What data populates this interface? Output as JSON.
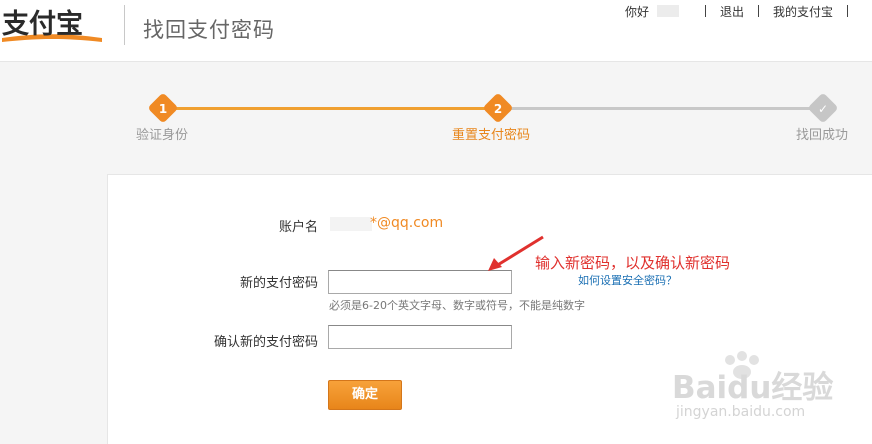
{
  "header": {
    "logo_text": "支付宝",
    "title": "找回支付密码",
    "nav": {
      "greeting": "你好",
      "logout": "退出",
      "my_alipay": "我的支付宝"
    }
  },
  "steps": [
    {
      "number": "1",
      "label": "验证身份",
      "state": "done"
    },
    {
      "number": "2",
      "label": "重置支付密码",
      "state": "active"
    },
    {
      "number": "✓",
      "label": "找回成功",
      "state": "pending"
    }
  ],
  "form": {
    "account_label": "账户名",
    "account_value": "*@qq.com",
    "new_password_label": "新的支付密码",
    "new_password_hint": "必须是6-20个英文字母、数字或符号，不能是纯数字",
    "help_link": "如何设置安全密码？",
    "confirm_password_label": "确认新的支付密码",
    "submit_label": "确定"
  },
  "annotation": {
    "text": "输入新密码，以及确认新密码",
    "color": "#e0312e"
  },
  "watermark": {
    "line1": "Baidu经验",
    "line2": "jingyan.baidu.com"
  },
  "colors": {
    "accent": "#f08a24",
    "link": "#1a6fb3"
  }
}
